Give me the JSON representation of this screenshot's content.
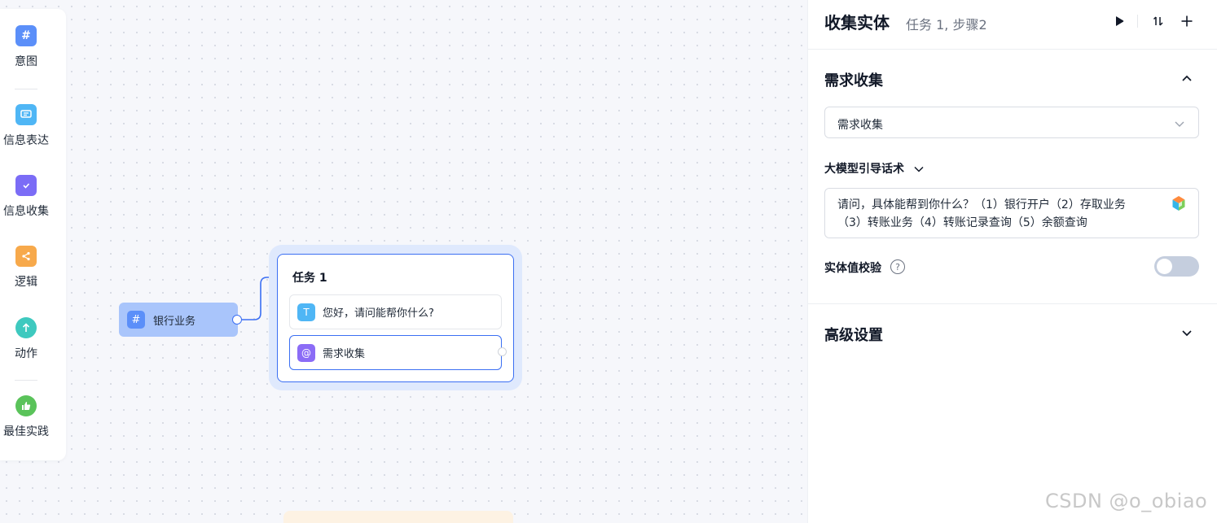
{
  "toolbar": {
    "items": [
      {
        "label": "意图",
        "icon": "hash-icon",
        "color": "#5b8ff9"
      },
      {
        "label": "信息表达",
        "icon": "message-icon",
        "color": "#4fb6f5"
      },
      {
        "label": "信息收集",
        "icon": "folder-check-icon",
        "color": "#7b6cf6"
      },
      {
        "label": "逻辑",
        "icon": "branch-icon",
        "color": "#f7a94b"
      },
      {
        "label": "动作",
        "icon": "arrow-up-hex-icon",
        "color": "#3ec9bf"
      },
      {
        "label": "最佳实践",
        "icon": "thumbs-up-icon",
        "color": "#5ac35a"
      }
    ]
  },
  "canvas": {
    "intent_node": {
      "label": "银行业务"
    },
    "task_node": {
      "title": "任务 1",
      "rows": [
        {
          "label": "您好，请问能帮你什么?",
          "icon": "text-icon"
        },
        {
          "label": "需求收集",
          "icon": "at-icon"
        }
      ]
    }
  },
  "panel": {
    "title": "收集实体",
    "subtitle": "任务 1, 步骤2",
    "section1": {
      "title": "需求收集",
      "select_value": "需求收集",
      "prompt_label": "大模型引导话术",
      "prompt_text": "请问，具体能帮到你什么？（1）银行开户（2）存取业务（3）转账业务（4）转账记录查询（5）余额查询",
      "verify_label": "实体值校验",
      "help": "?"
    },
    "section2": {
      "title": "高级设置"
    }
  },
  "watermark": "CSDN @o_obiao"
}
